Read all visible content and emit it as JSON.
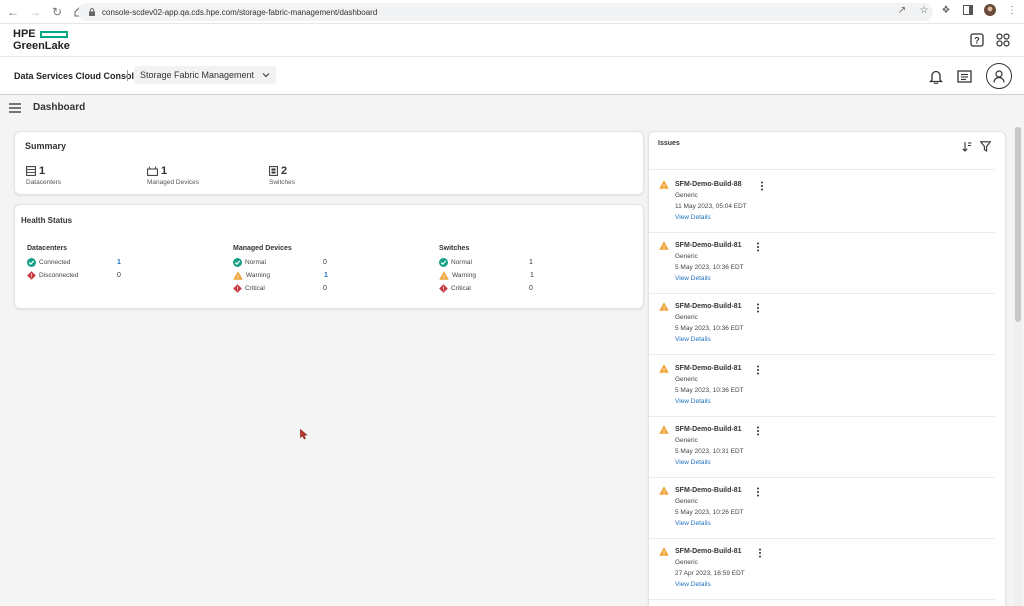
{
  "browser": {
    "url": "console-scdev02-app.qa.cds.hpe.com/storage-fabric-management/dashboard"
  },
  "app": {
    "logo_line1": "HPE",
    "logo_line2": "GreenLake",
    "brand_color": "#01a982"
  },
  "subheader": {
    "console_name": "Data Services Cloud Console",
    "service": "Storage Fabric Management"
  },
  "page": {
    "title": "Dashboard"
  },
  "summary": {
    "title": "Summary",
    "items": [
      {
        "count": "1",
        "label": "Datacenters",
        "icon": "datacenter-icon"
      },
      {
        "count": "1",
        "label": "Managed Devices",
        "icon": "device-icon"
      },
      {
        "count": "2",
        "label": "Switches",
        "icon": "switch-icon"
      }
    ]
  },
  "health": {
    "title": "Health Status",
    "datacenters": {
      "title": "Datacenters",
      "rows": [
        {
          "label": "Connected",
          "count": "1",
          "status": "ok"
        },
        {
          "label": "Disconnected",
          "count": "0",
          "status": "critical"
        }
      ]
    },
    "devices": {
      "title": "Managed Devices",
      "rows": [
        {
          "label": "Normal",
          "count": "0",
          "status": "ok"
        },
        {
          "label": "Warning",
          "count": "1",
          "status": "warning"
        },
        {
          "label": "Critical",
          "count": "0",
          "status": "critical"
        }
      ]
    },
    "switches": {
      "title": "Switches",
      "rows": [
        {
          "label": "Normal",
          "count": "1",
          "status": "ok"
        },
        {
          "label": "Warning",
          "count": "1",
          "status": "warning"
        },
        {
          "label": "Critical",
          "count": "0",
          "status": "critical"
        }
      ]
    }
  },
  "issues": {
    "title": "Issues",
    "view_label": "View Details",
    "items": [
      {
        "name": "SFM-Demo-Build-88",
        "type": "Generic",
        "date": "11 May 2023, 05:04 EDT"
      },
      {
        "name": "SFM-Demo-Build-81",
        "type": "Generic",
        "date": "5 May 2023, 10:36 EDT"
      },
      {
        "name": "SFM-Demo-Build-81",
        "type": "Generic",
        "date": "5 May 2023, 10:36 EDT"
      },
      {
        "name": "SFM-Demo-Build-81",
        "type": "Generic",
        "date": "5 May 2023, 10:36 EDT"
      },
      {
        "name": "SFM-Demo-Build-81",
        "type": "Generic",
        "date": "5 May 2023, 10:31 EDT"
      },
      {
        "name": "SFM-Demo-Build-81",
        "type": "Generic",
        "date": "5 May 2023, 10:26 EDT"
      },
      {
        "name": "SFM-Demo-Build-81",
        "type": "Generic",
        "date": "27 Apr 2023, 16:59 EDT"
      }
    ]
  },
  "colors": {
    "ok": "#17a086",
    "warning": "#f0a43a",
    "critical": "#c7383f",
    "link": "#1f6fbf"
  }
}
